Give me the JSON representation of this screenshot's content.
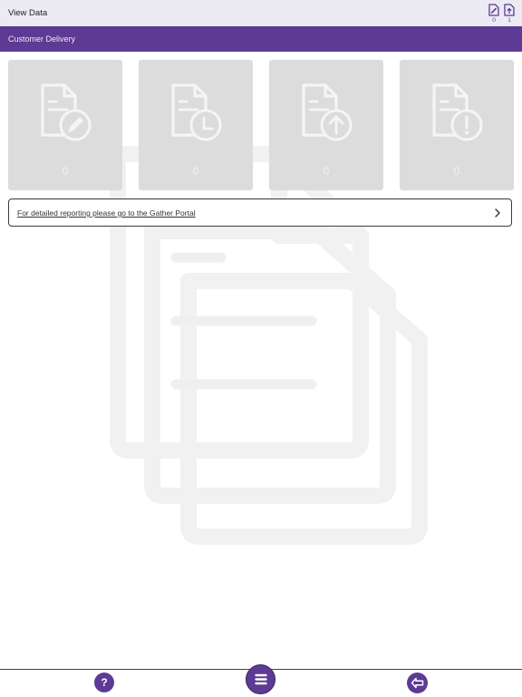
{
  "header": {
    "title": "View Data",
    "icons": [
      {
        "icon": "document-edit-icon",
        "count": "0"
      },
      {
        "icon": "document-upload-icon",
        "count": "1"
      }
    ]
  },
  "subheader": {
    "title": "Customer Delivery"
  },
  "tiles": [
    {
      "icon": "document-edit-icon",
      "value": "0"
    },
    {
      "icon": "document-clock-icon",
      "value": "0"
    },
    {
      "icon": "document-upload-icon",
      "value": "0"
    },
    {
      "icon": "document-alert-icon",
      "value": "0"
    }
  ],
  "portal_link": {
    "text": "For detailed reporting please go to the Gather Portal"
  },
  "bottom_nav": {
    "help_label": "?",
    "menu_icon": "hamburger-menu-icon",
    "back_icon": "back-arrow-icon"
  },
  "colors": {
    "brand_purple": "#5d3a93",
    "tile_gray": "#dcdcdc",
    "topbar_bg": "#eceaf3"
  }
}
